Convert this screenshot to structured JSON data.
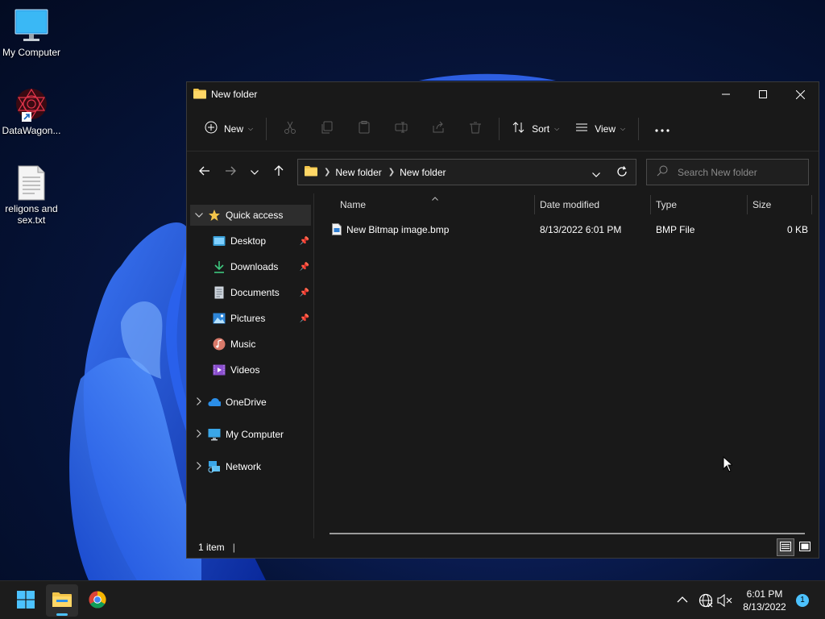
{
  "desktop": {
    "icons": [
      {
        "label": "My Computer",
        "icon": "monitor-icon"
      },
      {
        "label": "DataWagon...",
        "icon": "datawagon-shortcut-icon"
      },
      {
        "label": "religons and sex.txt",
        "icon": "text-file-icon"
      }
    ]
  },
  "window": {
    "title": "New folder",
    "controls": [
      "minimize",
      "maximize",
      "close"
    ],
    "toolbar": {
      "new_label": "New",
      "sort_label": "Sort",
      "view_label": "View"
    },
    "address": {
      "crumbs": [
        "New folder",
        "New folder"
      ]
    },
    "search": {
      "placeholder": "Search New folder"
    },
    "nav": {
      "quick_access": "Quick access",
      "items": [
        {
          "label": "Desktop",
          "icon": "desktop-icon",
          "pinned": true
        },
        {
          "label": "Downloads",
          "icon": "download-icon",
          "pinned": true
        },
        {
          "label": "Documents",
          "icon": "documents-icon",
          "pinned": true
        },
        {
          "label": "Pictures",
          "icon": "pictures-icon",
          "pinned": true
        },
        {
          "label": "Music",
          "icon": "music-icon",
          "pinned": false
        },
        {
          "label": "Videos",
          "icon": "videos-icon",
          "pinned": false
        }
      ],
      "onedrive": "OneDrive",
      "my_computer": "My Computer",
      "network": "Network"
    },
    "columns": {
      "name": "Name",
      "date": "Date modified",
      "type": "Type",
      "size": "Size"
    },
    "files": [
      {
        "name": "New Bitmap image.bmp",
        "date": "8/13/2022 6:01 PM",
        "type": "BMP File",
        "size": "0 KB"
      }
    ],
    "status": "1 item"
  },
  "taskbar": {
    "apps": [
      "start-icon",
      "file-explorer-icon",
      "chrome-icon"
    ],
    "clock_time": "6:01 PM",
    "clock_date": "8/13/2022",
    "notifications": "1"
  },
  "colors": {
    "accent": "#4cc2ff",
    "window_bg": "#191919",
    "folder": "#f3c54a"
  }
}
